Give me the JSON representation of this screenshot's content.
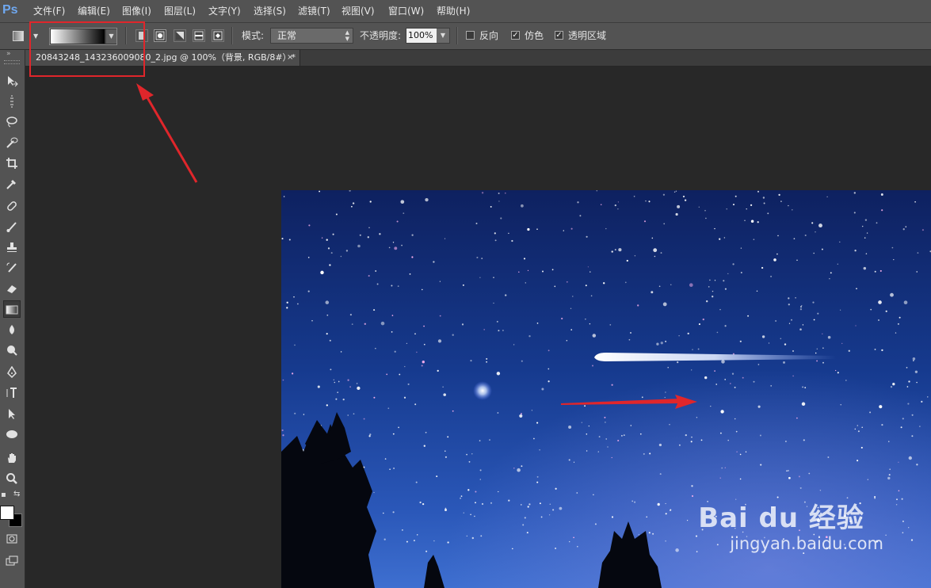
{
  "app": {
    "logo": "Ps"
  },
  "menu": [
    "文件(F)",
    "编辑(E)",
    "图像(I)",
    "图层(L)",
    "文字(Y)",
    "选择(S)",
    "滤镜(T)",
    "视图(V)",
    "窗口(W)",
    "帮助(H)"
  ],
  "options": {
    "mode_label": "模式:",
    "mode_value": "正常",
    "opacity_label": "不透明度:",
    "opacity_value": "100%",
    "reverse_label": "反向",
    "reverse_checked": false,
    "dither_label": "仿色",
    "dither_checked": true,
    "transparency_label": "透明区域",
    "transparency_checked": true,
    "gradient_type_active": "radial"
  },
  "document": {
    "tab_title": "20843248_143236009080_2.jpg  @  100%（背景, RGB/8#）*",
    "close_glyph": "×"
  },
  "toolbar": {
    "active_tool": "gradient",
    "foreground_color": "#ffffff",
    "background_color": "#000000"
  },
  "watermark": {
    "main": "Bai du 经验",
    "sub": "jingyan.baidu.com"
  },
  "colors": {
    "chrome": "#535353",
    "workspace": "#282828",
    "highlight": "#e0262b",
    "sky": "#1a3a8a"
  }
}
